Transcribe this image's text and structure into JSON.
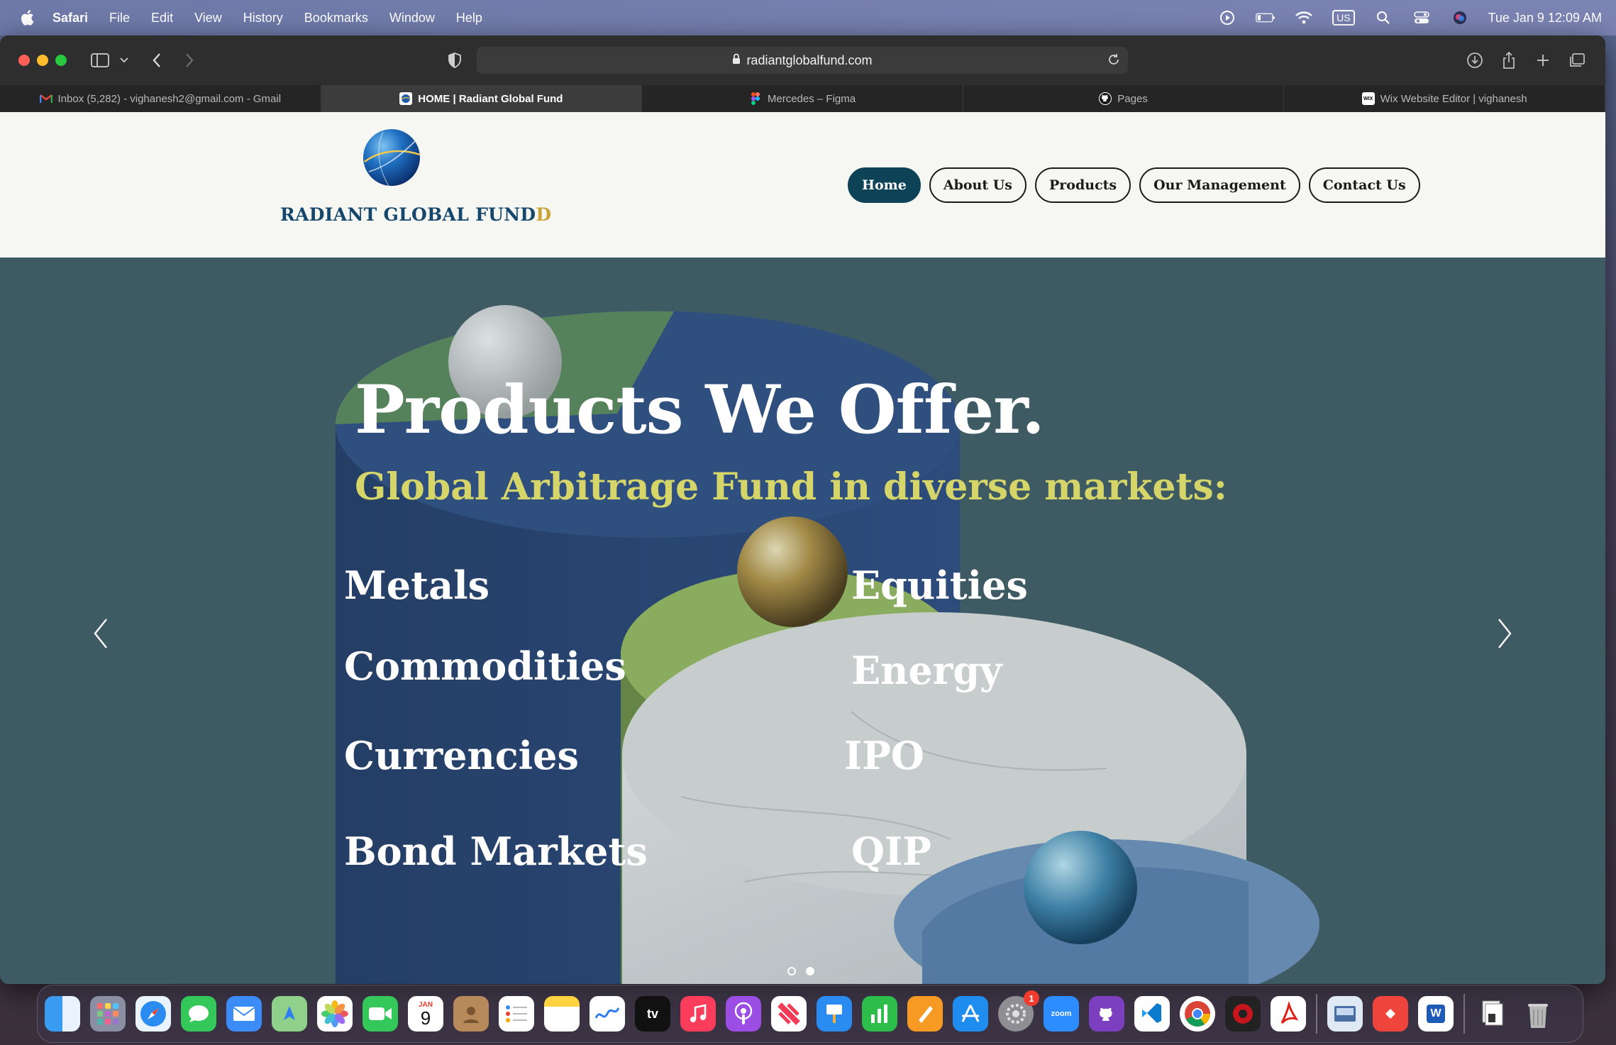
{
  "menubar": {
    "items": [
      "Safari",
      "File",
      "Edit",
      "View",
      "History",
      "Bookmarks",
      "Window",
      "Help"
    ],
    "keyboard": "US",
    "datetime": "Tue Jan 9  12:09 AM"
  },
  "browser": {
    "url": "radiantglobalfund.com",
    "tabs": [
      {
        "title": "Inbox (5,282) - vighanesh2@gmail.com - Gmail",
        "icon": "gmail-icon",
        "active": false
      },
      {
        "title": "HOME | Radiant Global Fund",
        "icon": "radiant-icon",
        "active": true
      },
      {
        "title": "Mercedes – Figma",
        "icon": "figma-icon",
        "active": false
      },
      {
        "title": "Pages",
        "icon": "github-icon",
        "active": false
      },
      {
        "title": "Wix Website Editor | vighanesh",
        "icon": "wix-icon",
        "active": false
      }
    ]
  },
  "site": {
    "logo": {
      "main": "RADIANT GLOBAL FUND",
      "accent": "D"
    },
    "nav": [
      {
        "label": "Home",
        "active": true
      },
      {
        "label": "About Us",
        "active": false
      },
      {
        "label": "Products",
        "active": false
      },
      {
        "label": "Our Management",
        "active": false
      },
      {
        "label": "Contact Us",
        "active": false
      }
    ],
    "hero": {
      "title": "Products We Offer.",
      "subtitle": "Global Arbitrage Fund in diverse markets:",
      "products_left": [
        "Metals",
        "Commodities",
        "Currencies",
        "Bond Markets"
      ],
      "products_right": [
        "Equities",
        "Energy",
        "IPO",
        "QIP"
      ]
    }
  },
  "dock": {
    "apps": [
      "finder-icon",
      "launchpad-icon",
      "safari-icon",
      "messages-icon",
      "mail-icon",
      "maps-icon",
      "photos-icon",
      "facetime-icon",
      "calendar-icon",
      "contacts-icon",
      "reminders-icon",
      "notes-icon",
      "freeform-icon",
      "tv-icon",
      "music-icon",
      "podcasts-icon",
      "news-icon",
      "keynote-icon",
      "numbers-icon",
      "pages-icon",
      "app-store-icon",
      "system-settings-icon",
      "zoom-icon",
      "github-desktop-icon",
      "vscode-icon",
      "chrome-icon",
      "acrobat-icon",
      "adobe-reader-icon",
      "preview-icon",
      "anydesk-icon",
      "word-icon",
      "documents-icon",
      "trash-icon"
    ],
    "calendar": {
      "month": "JAN",
      "day": "9"
    },
    "tv_label": "tv",
    "zoom_label": "zoom",
    "settings_badge": "1",
    "word_letter": "W"
  },
  "colors": {
    "hero_bg": "#3f5b63",
    "nav_active": "#0e4257",
    "subtitle": "#d6d56a",
    "logo_text": "#14476b",
    "logo_accent": "#c8a436"
  }
}
